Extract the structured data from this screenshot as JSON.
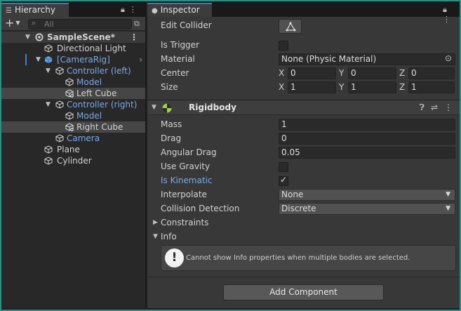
{
  "hierarchy": {
    "tab_label": "Hierarchy",
    "search_placeholder": "All",
    "scene_name": "SampleScene*",
    "items": [
      {
        "label": "Directional Light",
        "prefab": false
      },
      {
        "label": "[CameraRig]",
        "prefab": true
      },
      {
        "label": "Controller (left)",
        "prefab": true
      },
      {
        "label": "Model",
        "prefab": true
      },
      {
        "label": "Left Cube",
        "prefab": false
      },
      {
        "label": "Controller (right)",
        "prefab": true
      },
      {
        "label": "Model",
        "prefab": true
      },
      {
        "label": "Right Cube",
        "prefab": false
      },
      {
        "label": "Camera",
        "prefab": true
      },
      {
        "label": "Plane",
        "prefab": false
      },
      {
        "label": "Cylinder",
        "prefab": false
      }
    ]
  },
  "inspector": {
    "tab_label": "Inspector",
    "collider": {
      "edit_collider_label": "Edit Collider",
      "is_trigger_label": "Is Trigger",
      "is_trigger": false,
      "material_label": "Material",
      "material_value": "None (Physic Material)",
      "center_label": "Center",
      "center": {
        "x": "0",
        "y": "0",
        "z": "0"
      },
      "size_label": "Size",
      "size": {
        "x": "1",
        "y": "1",
        "z": "1"
      }
    },
    "axis_labels": {
      "x": "X",
      "y": "Y",
      "z": "Z"
    },
    "rigidbody": {
      "title": "Rigidbody",
      "mass_label": "Mass",
      "mass": "1",
      "drag_label": "Drag",
      "drag": "0",
      "angular_drag_label": "Angular Drag",
      "angular_drag": "0.05",
      "use_gravity_label": "Use Gravity",
      "use_gravity": false,
      "is_kinematic_label": "Is Kinematic",
      "is_kinematic": true,
      "interpolate_label": "Interpolate",
      "interpolate": "None",
      "collision_detection_label": "Collision Detection",
      "collision_detection": "Discrete",
      "constraints_label": "Constraints",
      "info_label": "Info",
      "info_message": "Cannot show Info properties when multiple bodies are selected."
    },
    "add_component_label": "Add Component"
  },
  "colors": {
    "accent_border": "#2b8f86",
    "prefab_blue": "#7ba9e8",
    "tab_accent": "#3a79bb"
  }
}
